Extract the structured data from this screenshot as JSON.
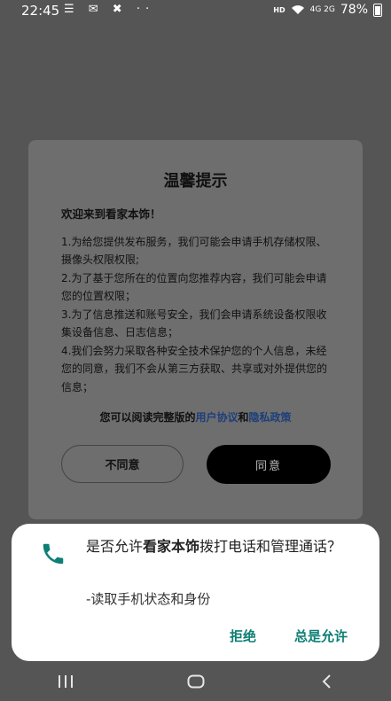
{
  "status_bar": {
    "time": "22:45",
    "left_icons": "☰ ✉ ✖ ··",
    "hd": "HD",
    "signal_text": "4G  2G",
    "battery": "78%"
  },
  "dialog": {
    "title": "温馨提示",
    "welcome": "欢迎来到看家本饰！",
    "items": [
      "1.为给您提供发布服务，我们可能会申请手机存储权限、 摄像头权限权限;",
      "2.为了基于您所在的位置向您推荐内容，我们可能会申请您的位置权限；",
      "3.为了信息推送和账号安全，我们会申请系统设备权限收集设备信息、日志信息；",
      "4.我们会努力采取各种安全技术保护您的个人信息，未经您的同意，我们不会从第三方获取、共享或对外提供您的信息；"
    ],
    "agree_prefix": "您可以阅读完整版的",
    "user_agreement": "用户协议",
    "and": "和",
    "privacy_policy": "隐私政策",
    "disagree": "不同意",
    "agree": "同意"
  },
  "permission": {
    "msg_prefix": "是否允许",
    "app_name": "看家本饰",
    "msg_suffix": "拨打电话和管理通话？",
    "detail": "-读取手机状态和身份",
    "deny": "拒绝",
    "allow": "总是允许",
    "icon": "phone-icon",
    "accent": "#0d7f75"
  },
  "navbar": {
    "icons": [
      "recents-icon",
      "home-icon",
      "back-icon"
    ]
  }
}
